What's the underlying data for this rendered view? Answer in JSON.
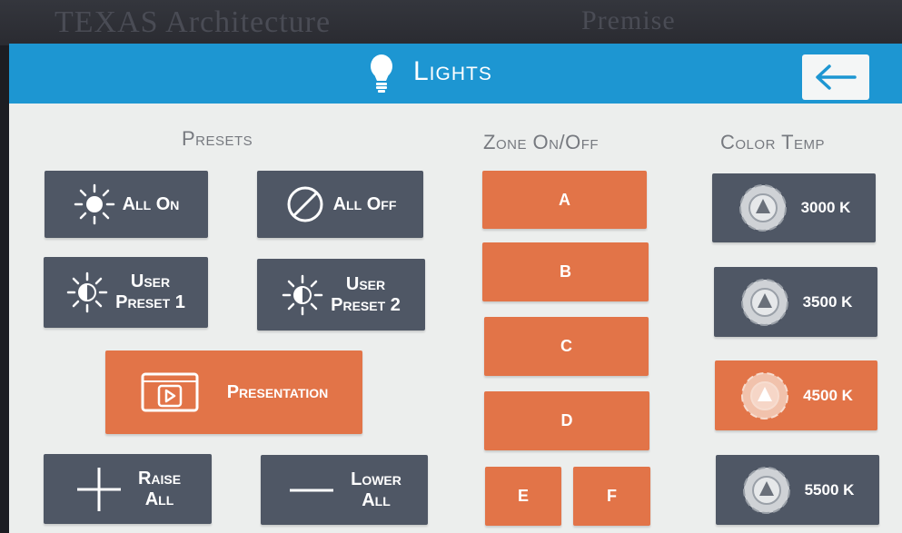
{
  "background": {
    "left_text": "TEXAS Architecture",
    "right_text": "Premise"
  },
  "header": {
    "title": "Lights",
    "back_icon": "left-arrow-icon",
    "title_icon": "lightbulb-icon",
    "color": "#1d96d2"
  },
  "presets": {
    "title": "Presets",
    "all_on": "All On",
    "all_off": "All Off",
    "user_preset_1": [
      "User",
      "Preset 1"
    ],
    "user_preset_2": [
      "User",
      "Preset 2"
    ],
    "presentation": "Presentation",
    "raise_all": [
      "Raise",
      "All"
    ],
    "lower_all": [
      "Lower",
      "All"
    ]
  },
  "zones": {
    "title": "Zone On/Off",
    "items": [
      "A",
      "B",
      "C",
      "D",
      "E",
      "F"
    ]
  },
  "color_temp": {
    "title": "Color Temp",
    "items": [
      "3000 K",
      "3500 K",
      "4500 K",
      "5500 K"
    ],
    "selected": "4500 K"
  },
  "colors": {
    "button": "#4f5765",
    "active": "#e27448",
    "panel": "#eceeed"
  }
}
